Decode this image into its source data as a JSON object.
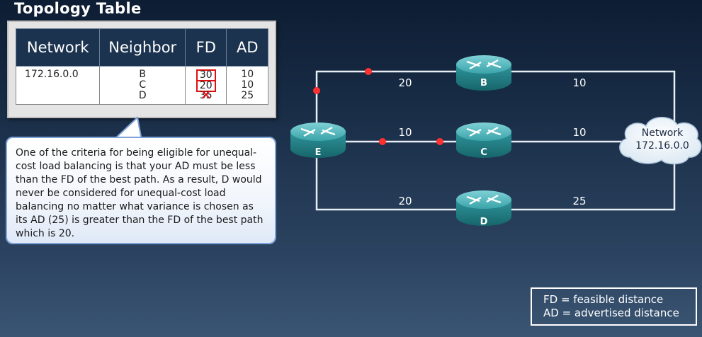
{
  "title": "Topology Table",
  "table": {
    "headers": {
      "network": "Network",
      "neighbor": "Neighbor",
      "fd": "FD",
      "ad": "AD"
    },
    "network": "172.16.0.0",
    "rows": [
      {
        "neighbor": "B",
        "fd": "30",
        "ad": "10",
        "fd_marked": "box"
      },
      {
        "neighbor": "C",
        "fd": "20",
        "ad": "10",
        "fd_marked": "box"
      },
      {
        "neighbor": "D",
        "fd": "35",
        "ad": "25",
        "fd_marked": "x"
      }
    ]
  },
  "callout": {
    "text": "One of the criteria for being eligible for unequal-cost load balancing is that your AD must be less than the FD of the best path. As a result, D would never be considered for unequal-cost load balancing no matter what variance is chosen as its AD (25) is greater than the FD of the best path which is 20."
  },
  "diagram": {
    "routers": {
      "e": "E",
      "b": "B",
      "c": "C",
      "d": "D"
    },
    "link_costs": {
      "e_b": "20",
      "b_net": "10",
      "e_c": "10",
      "c_net": "10",
      "e_d": "20",
      "d_net": "25"
    },
    "cloud": {
      "line1": "Network",
      "line2": "172.16.0.0"
    }
  },
  "legend": {
    "fd": "FD = feasible distance",
    "ad": "AD = advertised distance"
  },
  "colors": {
    "table_header": "#1c3350",
    "marker_red": "#e01010",
    "router": "#2a8f95"
  }
}
